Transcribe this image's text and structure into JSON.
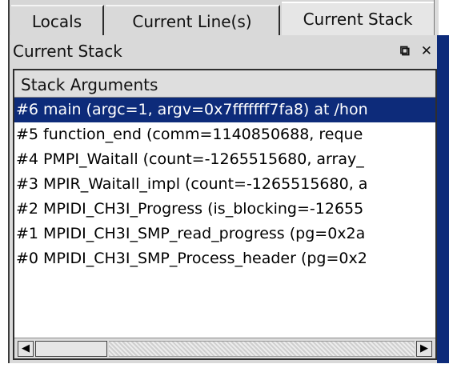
{
  "tabs": [
    {
      "label": "Locals"
    },
    {
      "label": "Current Line(s)"
    },
    {
      "label": "Current Stack",
      "active": true
    }
  ],
  "panel": {
    "title": "Current Stack",
    "float_icon": "float-icon",
    "close_icon": "close-icon",
    "float_glyph": "⧉",
    "close_glyph": "✕"
  },
  "stack": {
    "header": "Stack Arguments",
    "rows": [
      {
        "text": "#6 main (argc=1, argv=0x7fffffff7fa8) at /hon",
        "selected": true
      },
      {
        "text": "#5 function_end (comm=1140850688, reque"
      },
      {
        "text": "#4 PMPI_Waitall (count=-1265515680, array_"
      },
      {
        "text": "#3 MPIR_Waitall_impl (count=-1265515680, a"
      },
      {
        "text": "#2 MPIDI_CH3I_Progress (is_blocking=-12655"
      },
      {
        "text": "#1  MPIDI_CH3I_SMP_read_progress (pg=0x2a"
      },
      {
        "text": "#0 MPIDI_CH3I_SMP_Process_header (pg=0x2"
      }
    ]
  },
  "scrollbar": {
    "left_arrow": "◀",
    "right_arrow": "▶"
  },
  "colors": {
    "selection": "#0d2b7a",
    "panel_bg": "#d9d9d9"
  }
}
